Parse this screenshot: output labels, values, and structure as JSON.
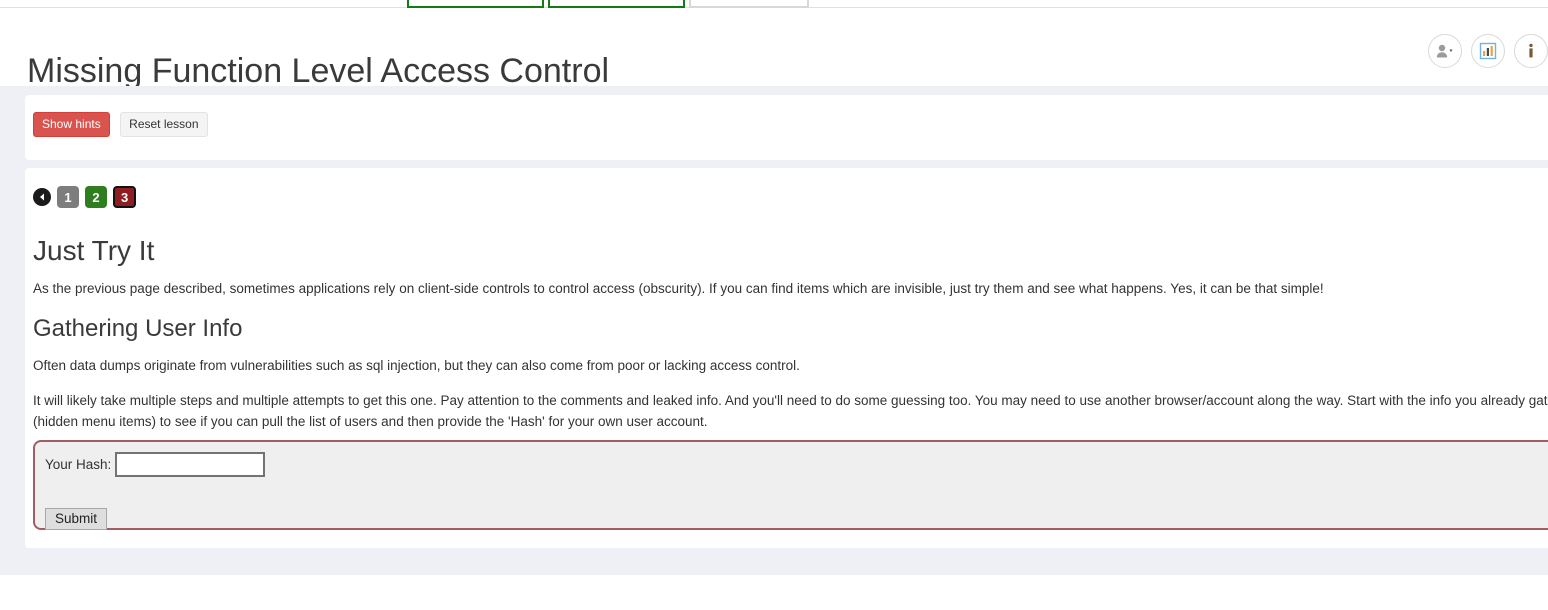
{
  "header": {
    "title": "Missing Function Level Access Control",
    "icons": [
      {
        "name": "user-menu-icon",
        "glyph": "user-caret"
      },
      {
        "name": "scoreboard-icon",
        "glyph": "bar-chart"
      },
      {
        "name": "about-info-icon",
        "glyph": "info"
      }
    ]
  },
  "top_menu": {
    "items": [
      "",
      "",
      ""
    ]
  },
  "hints": {
    "show_hints_label": "Show hints",
    "reset_lesson_label": "Reset lesson",
    "show_hints_color": "#d9534f",
    "reset_lesson_color": "#f4f4f4"
  },
  "pager": {
    "back_label": "◀",
    "pages": [
      {
        "label": "1",
        "state": "visited"
      },
      {
        "label": "2",
        "state": "solved"
      },
      {
        "label": "3",
        "state": "active"
      }
    ],
    "solved_color": "#2e7d1e",
    "active_color": "#8f1d22",
    "visited_color": "#7d7d7d"
  },
  "lesson": {
    "heading_1": "Just Try It",
    "paragraph_1": "As the previous page described, sometimes applications rely on client-side controls to control access (obscurity). If you can find items which are invisible, just try them and see what happens. Yes, it can be that simple!",
    "heading_2": "Gathering User Info",
    "paragraph_2": "Often data dumps originate from vulnerabilities such as sql injection, but they can also come from poor or lacking access control.",
    "paragraph_3": "It will likely take multiple steps and multiple attempts to get this one. Pay attention to the comments and leaked info. And you'll need to do some guessing too. You may need to use another browser/account along the way. Start with the info you already gathered (hidden menu items) to see if you can pull the list of users and then provide the 'Hash' for your own user account."
  },
  "form": {
    "hash_label": "Your Hash:",
    "hash_value": "",
    "hash_placeholder": "",
    "submit_label": "Submit",
    "border_color": "#a35d62",
    "background_color": "#efefef"
  }
}
